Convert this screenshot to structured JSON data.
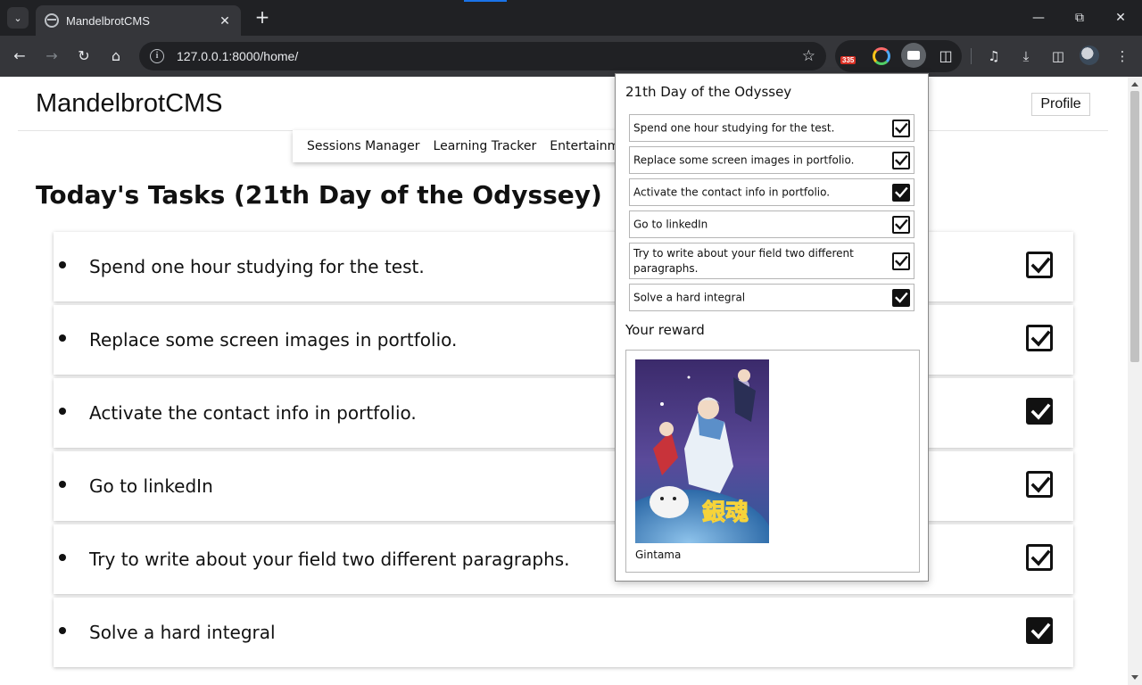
{
  "browser": {
    "tab_title": "MandelbrotCMS",
    "tab_close": "✕",
    "new_tab": "+",
    "url": "127.0.0.1:8000/home/",
    "extension_badge": "335"
  },
  "header": {
    "brand": "MandelbrotCMS",
    "profile_label": "Profile"
  },
  "menu": {
    "items": [
      "Sessions Manager",
      "Learning Tracker",
      "Entertainment"
    ]
  },
  "main": {
    "title": "Today's Tasks (21th Day of the Odyssey)",
    "tasks": [
      {
        "text": "Spend one hour studying for the test.",
        "checked": true,
        "style": "outline"
      },
      {
        "text": "Replace some screen images in portfolio.",
        "checked": true,
        "style": "outline"
      },
      {
        "text": "Activate the contact info in portfolio.",
        "checked": true,
        "style": "filled"
      },
      {
        "text": "Go to linkedIn",
        "checked": true,
        "style": "outline"
      },
      {
        "text": "Try to write about your field two different paragraphs.",
        "checked": true,
        "style": "outline"
      },
      {
        "text": "Solve a hard integral",
        "checked": true,
        "style": "filled"
      }
    ]
  },
  "popup": {
    "title": "21th Day of the Odyssey",
    "tasks": [
      {
        "text": "Spend one hour studying for the test.",
        "checked": true,
        "style": "outline"
      },
      {
        "text": "Replace some screen images in portfolio.",
        "checked": true,
        "style": "outline"
      },
      {
        "text": "Activate the contact info in portfolio.",
        "checked": true,
        "style": "filled"
      },
      {
        "text": "Go to linkedIn",
        "checked": true,
        "style": "outline"
      },
      {
        "text": "Try to write about your field two different paragraphs.",
        "checked": true,
        "style": "outline"
      },
      {
        "text": "Solve a hard integral",
        "checked": true,
        "style": "filled"
      }
    ],
    "reward_title": "Your reward",
    "reward_caption": "Gintama"
  },
  "colors": {
    "chrome_dark": "#202124",
    "chrome_toolbar": "#35363a",
    "chrome_text": "#e8eaed",
    "badge_red": "#d93025",
    "check_black": "#111111"
  }
}
